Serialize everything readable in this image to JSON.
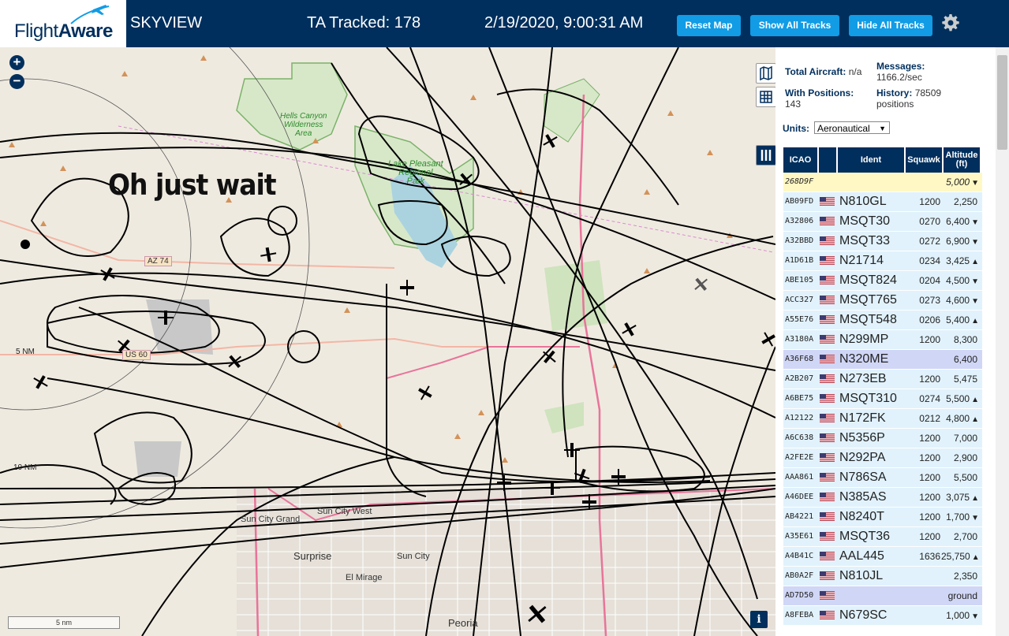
{
  "header": {
    "logo_a": "Flight",
    "logo_b": "Aware",
    "app_name": "SKYVIEW",
    "tracked": "TA Tracked: 178",
    "datetime": "2/19/2020, 9:00:31 AM",
    "btn_reset": "Reset Map",
    "btn_show": "Show All Tracks",
    "btn_hide": "Hide All Tracks"
  },
  "map": {
    "overlay_text": "Oh just wait",
    "labels": {
      "hells_canyon": "Hells Canyon\nWilderness\nArea",
      "lake_pleasant": "Lake Pleasant\nRegional\nPark",
      "az74": "AZ 74",
      "us60": "US 60",
      "sun_city_grand": "Sun City Grand",
      "sun_city_west": "Sun City West",
      "surprise": "Surprise",
      "sun_city": "Sun City",
      "el_mirage": "El Mirage",
      "peoria": "Peoria"
    },
    "range_5nm": "5 NM",
    "range_10nm": "10 NM",
    "scale": "5 nm",
    "info": "i"
  },
  "panel": {
    "total_label": "Total Aircraft:",
    "total_value": "n/a",
    "messages_label": "Messages:",
    "messages_value": "1166.2/sec",
    "positions_label": "With Positions:",
    "positions_value": "143",
    "history_label": "History:",
    "history_value": "78509 positions",
    "units_label": "Units:",
    "units_value": "Aeronautical",
    "columns": [
      "ICAO",
      "",
      "Ident",
      "Squawk",
      "Altitude (ft)"
    ],
    "rows": [
      {
        "icao": "268D9F",
        "flag": false,
        "ident": "",
        "squawk": "",
        "alt": "5,000",
        "trend": "▼",
        "bg": "#fff8c4",
        "italic": true
      },
      {
        "icao": "AB09FD",
        "flag": true,
        "ident": "N810GL",
        "squawk": "1200",
        "alt": "2,250",
        "trend": "",
        "bg": "#e1f2fc"
      },
      {
        "icao": "A32806",
        "flag": true,
        "ident": "MSQT30",
        "squawk": "0270",
        "alt": "6,400",
        "trend": "▼",
        "bg": "#e1f2fc"
      },
      {
        "icao": "A32BBD",
        "flag": true,
        "ident": "MSQT33",
        "squawk": "0272",
        "alt": "6,900",
        "trend": "▼",
        "bg": "#e1f2fc"
      },
      {
        "icao": "A1D61B",
        "flag": true,
        "ident": "N21714",
        "squawk": "0234",
        "alt": "3,425",
        "trend": "▲",
        "bg": "#e1f2fc"
      },
      {
        "icao": "ABE105",
        "flag": true,
        "ident": "MSQT824",
        "squawk": "0204",
        "alt": "4,500",
        "trend": "▼",
        "bg": "#e1f2fc"
      },
      {
        "icao": "ACC327",
        "flag": true,
        "ident": "MSQT765",
        "squawk": "0273",
        "alt": "4,600",
        "trend": "▼",
        "bg": "#e1f2fc"
      },
      {
        "icao": "A55E76",
        "flag": true,
        "ident": "MSQT548",
        "squawk": "0206",
        "alt": "5,400",
        "trend": "▲",
        "bg": "#e1f2fc"
      },
      {
        "icao": "A3180A",
        "flag": true,
        "ident": "N299MP",
        "squawk": "1200",
        "alt": "8,300",
        "trend": "",
        "bg": "#e1f2fc"
      },
      {
        "icao": "A36F68",
        "flag": true,
        "ident": "N320ME",
        "squawk": "",
        "alt": "6,400",
        "trend": "",
        "bg": "#d0d6f5"
      },
      {
        "icao": "A2B207",
        "flag": true,
        "ident": "N273EB",
        "squawk": "1200",
        "alt": "5,475",
        "trend": "",
        "bg": "#e1f2fc"
      },
      {
        "icao": "A6BE75",
        "flag": true,
        "ident": "MSQT310",
        "squawk": "0274",
        "alt": "5,500",
        "trend": "▲",
        "bg": "#e1f2fc"
      },
      {
        "icao": "A12122",
        "flag": true,
        "ident": "N172FK",
        "squawk": "0212",
        "alt": "4,800",
        "trend": "▲",
        "bg": "#e1f2fc"
      },
      {
        "icao": "A6C638",
        "flag": true,
        "ident": "N5356P",
        "squawk": "1200",
        "alt": "7,000",
        "trend": "",
        "bg": "#e1f2fc"
      },
      {
        "icao": "A2FE2E",
        "flag": true,
        "ident": "N292PA",
        "squawk": "1200",
        "alt": "2,900",
        "trend": "",
        "bg": "#e1f2fc"
      },
      {
        "icao": "AAA861",
        "flag": true,
        "ident": "N786SA",
        "squawk": "1200",
        "alt": "5,500",
        "trend": "",
        "bg": "#e1f2fc"
      },
      {
        "icao": "A46DEE",
        "flag": true,
        "ident": "N385AS",
        "squawk": "1200",
        "alt": "3,075",
        "trend": "▲",
        "bg": "#e1f2fc"
      },
      {
        "icao": "AB4221",
        "flag": true,
        "ident": "N8240T",
        "squawk": "1200",
        "alt": "1,700",
        "trend": "▼",
        "bg": "#e1f2fc"
      },
      {
        "icao": "A35E61",
        "flag": true,
        "ident": "MSQT36",
        "squawk": "1200",
        "alt": "2,700",
        "trend": "",
        "bg": "#e1f2fc"
      },
      {
        "icao": "A4B41C",
        "flag": true,
        "ident": "AAL445",
        "squawk": "1636",
        "alt": "25,750",
        "trend": "▲",
        "bg": "#e1f2fc"
      },
      {
        "icao": "AB0A2F",
        "flag": true,
        "ident": "N810JL",
        "squawk": "",
        "alt": "2,350",
        "trend": "",
        "bg": "#e1f2fc"
      },
      {
        "icao": "AD7D50",
        "flag": true,
        "ident": "",
        "squawk": "",
        "alt": "ground",
        "trend": "",
        "bg": "#d0d6f5"
      },
      {
        "icao": "A8FEBA",
        "flag": true,
        "ident": "N679SC",
        "squawk": "",
        "alt": "1,000",
        "trend": "▼",
        "bg": "#e1f2fc"
      }
    ]
  },
  "colors": {
    "header": "#002f5d",
    "button": "#119ce5",
    "row": "#e1f2fc",
    "row_selected": "#d0d6f5",
    "row_noposition": "#fff8c4"
  }
}
